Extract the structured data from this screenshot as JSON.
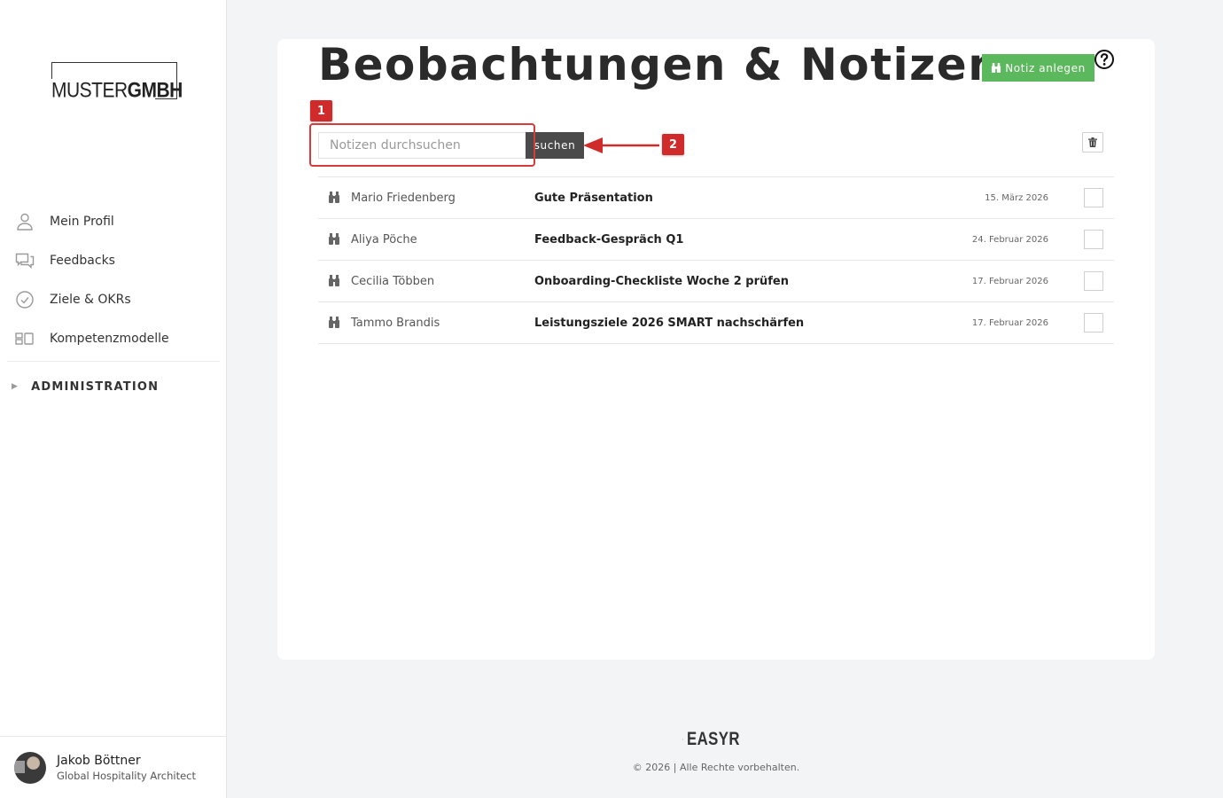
{
  "sidebar": {
    "logo": {
      "part1": "MUSTER",
      "part2": "GMBH"
    },
    "nav": [
      {
        "label": "Mein Profil",
        "icon": "user-icon"
      },
      {
        "label": "Feedbacks",
        "icon": "chat-icon"
      },
      {
        "label": "Ziele & OKRs",
        "icon": "check-circle-icon"
      },
      {
        "label": "Kompetenzmodelle",
        "icon": "blocks-icon"
      }
    ],
    "admin": {
      "label": "ADMINISTRATION",
      "caret": "▶"
    },
    "user": {
      "name": "Jakob Böttner",
      "role": "Global Hospitality Architect"
    }
  },
  "page": {
    "title": "Beobachtungen & Notizen",
    "add_button": "Notiz anlegen",
    "help_icon": "help-circle-icon",
    "search": {
      "placeholder": "Notizen durchsuchen",
      "value": "",
      "button": "suchen"
    },
    "trash_icon": "trash-icon"
  },
  "notes": [
    {
      "person": "Mario Friedenberg",
      "title": "Gute Präsentation",
      "date": "15. März 2026"
    },
    {
      "person": "Aliya Pöche",
      "title": "Feedback-Gespräch Q1",
      "date": "24. Februar 2026"
    },
    {
      "person": "Cecilia Többen",
      "title": "Onboarding-Checkliste Woche 2 prüfen",
      "date": "17. Februar 2026"
    },
    {
      "person": "Tammo Brandis",
      "title": "Leistungsziele 2026 SMART nachschärfen",
      "date": "17. Februar 2026"
    }
  ],
  "annotations": {
    "marker1": "1",
    "marker2": "2"
  },
  "footer": {
    "brand": "EASYR",
    "copyright": "© 2026 | Alle Rechte vorbehalten."
  },
  "colors": {
    "accent_green": "#5cb85c",
    "dark_button": "#4a4a4a",
    "annotation_red": "#d12a2a"
  }
}
